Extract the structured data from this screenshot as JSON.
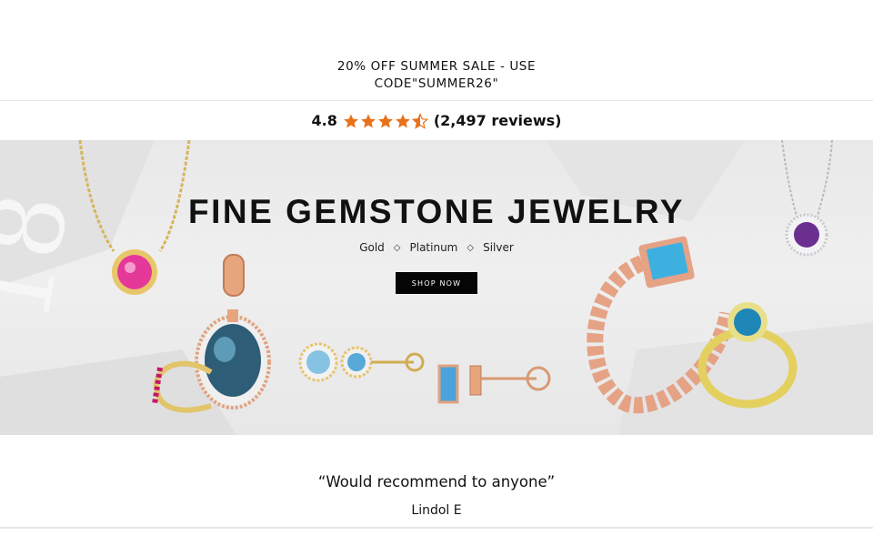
{
  "promo": {
    "line1": "20% OFF SUMMER SALE - USE",
    "line2": "CODE\"SUMMER26\""
  },
  "rating": {
    "score": "4.8",
    "stars": 4.5,
    "reviews": "(2,497 reviews)",
    "star_color": "#e8721c"
  },
  "hero": {
    "title": "FINE GEMSTONE JEWELRY",
    "metals": [
      "Gold",
      "Platinum",
      "Silver"
    ],
    "separator_icon": "diamond-icon",
    "cta": "SHOP NOW",
    "product_images": [
      "pink-gem-necklace",
      "amethyst-halo-necklace",
      "blue-oval-pendant",
      "ruby-hoop-earring",
      "blue-topaz-halo-stud",
      "blue-baguette-stud",
      "rose-gold-chain-ring",
      "gold-bypass-ring"
    ]
  },
  "testimonial": {
    "quote": "“Would recommend to anyone”",
    "author": "Lindol E"
  }
}
